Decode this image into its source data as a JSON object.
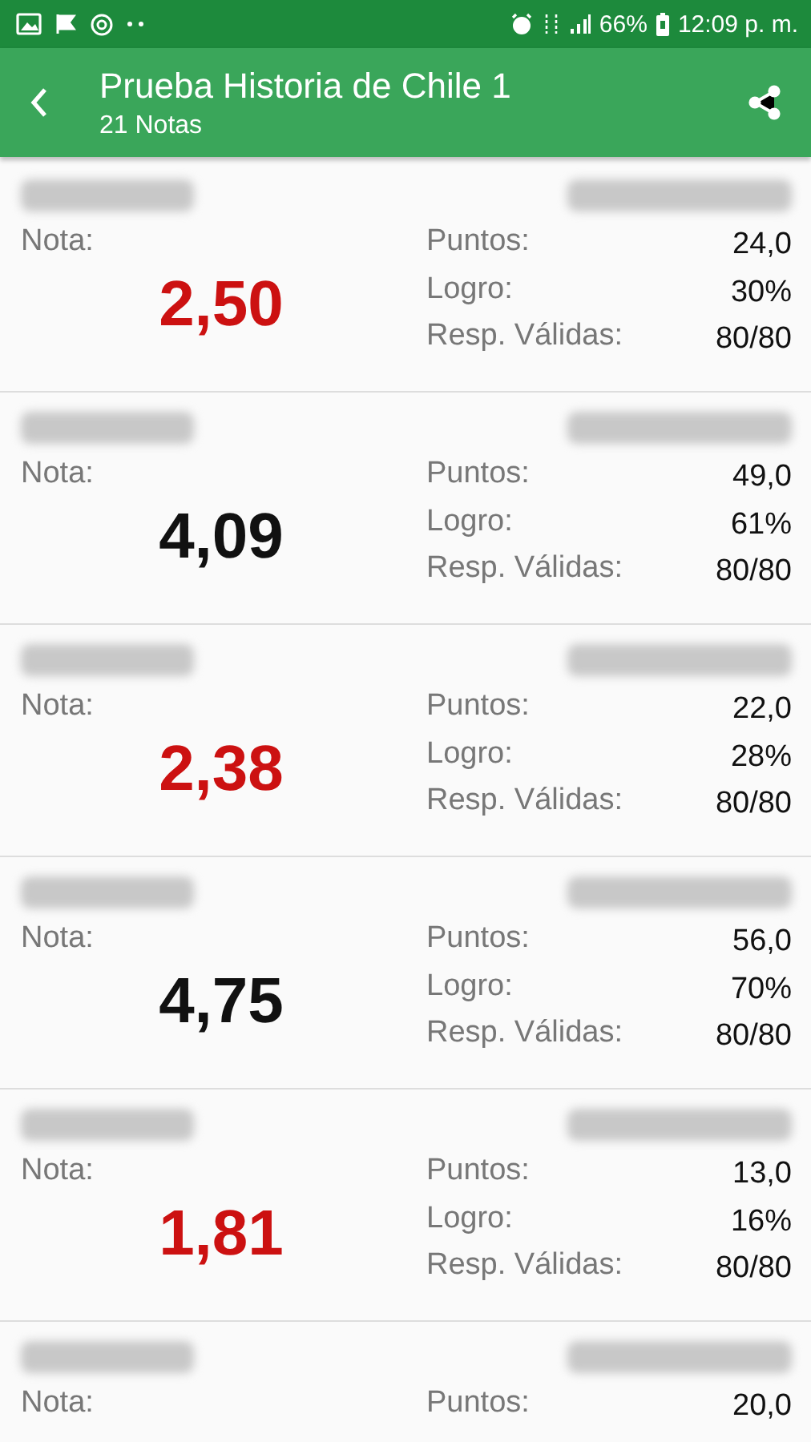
{
  "status_bar": {
    "battery": "66%",
    "time": "12:09 p. m."
  },
  "app_bar": {
    "title": "Prueba Historia de Chile 1",
    "subtitle": "21 Notas"
  },
  "results": [
    {
      "nota_label": "Nota:",
      "nota": "2,50",
      "failing": true,
      "stats": [
        {
          "label": "Puntos:",
          "value": "24,0"
        },
        {
          "label": "Logro:",
          "value": "30%"
        },
        {
          "label": "Resp. Válidas:",
          "value": "80/80"
        }
      ]
    },
    {
      "nota_label": "Nota:",
      "nota": "4,09",
      "failing": false,
      "stats": [
        {
          "label": "Puntos:",
          "value": "49,0"
        },
        {
          "label": "Logro:",
          "value": "61%"
        },
        {
          "label": "Resp. Válidas:",
          "value": "80/80"
        }
      ]
    },
    {
      "nota_label": "Nota:",
      "nota": "2,38",
      "failing": true,
      "stats": [
        {
          "label": "Puntos:",
          "value": "22,0"
        },
        {
          "label": "Logro:",
          "value": "28%"
        },
        {
          "label": "Resp. Válidas:",
          "value": "80/80"
        }
      ]
    },
    {
      "nota_label": "Nota:",
      "nota": "4,75",
      "failing": false,
      "stats": [
        {
          "label": "Puntos:",
          "value": "56,0"
        },
        {
          "label": "Logro:",
          "value": "70%"
        },
        {
          "label": "Resp. Válidas:",
          "value": "80/80"
        }
      ]
    },
    {
      "nota_label": "Nota:",
      "nota": "1,81",
      "failing": true,
      "stats": [
        {
          "label": "Puntos:",
          "value": "13,0"
        },
        {
          "label": "Logro:",
          "value": "16%"
        },
        {
          "label": "Resp. Válidas:",
          "value": "80/80"
        }
      ]
    },
    {
      "nota_label": "Nota:",
      "stats": [
        {
          "label": "Puntos:",
          "value": "20,0"
        }
      ]
    }
  ]
}
